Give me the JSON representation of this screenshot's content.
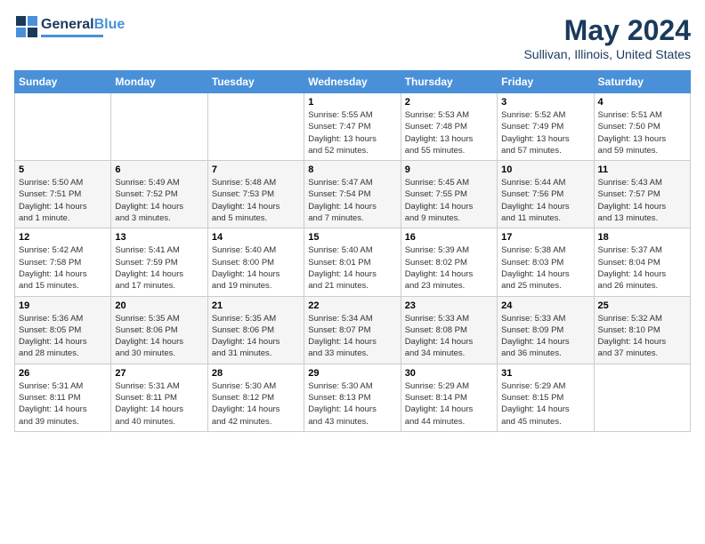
{
  "header": {
    "logo_general": "General",
    "logo_blue": "Blue",
    "month_year": "May 2024",
    "location": "Sullivan, Illinois, United States"
  },
  "weekdays": [
    "Sunday",
    "Monday",
    "Tuesday",
    "Wednesday",
    "Thursday",
    "Friday",
    "Saturday"
  ],
  "weeks": [
    [
      {
        "day": "",
        "info": ""
      },
      {
        "day": "",
        "info": ""
      },
      {
        "day": "",
        "info": ""
      },
      {
        "day": "1",
        "info": "Sunrise: 5:55 AM\nSunset: 7:47 PM\nDaylight: 13 hours\nand 52 minutes."
      },
      {
        "day": "2",
        "info": "Sunrise: 5:53 AM\nSunset: 7:48 PM\nDaylight: 13 hours\nand 55 minutes."
      },
      {
        "day": "3",
        "info": "Sunrise: 5:52 AM\nSunset: 7:49 PM\nDaylight: 13 hours\nand 57 minutes."
      },
      {
        "day": "4",
        "info": "Sunrise: 5:51 AM\nSunset: 7:50 PM\nDaylight: 13 hours\nand 59 minutes."
      }
    ],
    [
      {
        "day": "5",
        "info": "Sunrise: 5:50 AM\nSunset: 7:51 PM\nDaylight: 14 hours\nand 1 minute."
      },
      {
        "day": "6",
        "info": "Sunrise: 5:49 AM\nSunset: 7:52 PM\nDaylight: 14 hours\nand 3 minutes."
      },
      {
        "day": "7",
        "info": "Sunrise: 5:48 AM\nSunset: 7:53 PM\nDaylight: 14 hours\nand 5 minutes."
      },
      {
        "day": "8",
        "info": "Sunrise: 5:47 AM\nSunset: 7:54 PM\nDaylight: 14 hours\nand 7 minutes."
      },
      {
        "day": "9",
        "info": "Sunrise: 5:45 AM\nSunset: 7:55 PM\nDaylight: 14 hours\nand 9 minutes."
      },
      {
        "day": "10",
        "info": "Sunrise: 5:44 AM\nSunset: 7:56 PM\nDaylight: 14 hours\nand 11 minutes."
      },
      {
        "day": "11",
        "info": "Sunrise: 5:43 AM\nSunset: 7:57 PM\nDaylight: 14 hours\nand 13 minutes."
      }
    ],
    [
      {
        "day": "12",
        "info": "Sunrise: 5:42 AM\nSunset: 7:58 PM\nDaylight: 14 hours\nand 15 minutes."
      },
      {
        "day": "13",
        "info": "Sunrise: 5:41 AM\nSunset: 7:59 PM\nDaylight: 14 hours\nand 17 minutes."
      },
      {
        "day": "14",
        "info": "Sunrise: 5:40 AM\nSunset: 8:00 PM\nDaylight: 14 hours\nand 19 minutes."
      },
      {
        "day": "15",
        "info": "Sunrise: 5:40 AM\nSunset: 8:01 PM\nDaylight: 14 hours\nand 21 minutes."
      },
      {
        "day": "16",
        "info": "Sunrise: 5:39 AM\nSunset: 8:02 PM\nDaylight: 14 hours\nand 23 minutes."
      },
      {
        "day": "17",
        "info": "Sunrise: 5:38 AM\nSunset: 8:03 PM\nDaylight: 14 hours\nand 25 minutes."
      },
      {
        "day": "18",
        "info": "Sunrise: 5:37 AM\nSunset: 8:04 PM\nDaylight: 14 hours\nand 26 minutes."
      }
    ],
    [
      {
        "day": "19",
        "info": "Sunrise: 5:36 AM\nSunset: 8:05 PM\nDaylight: 14 hours\nand 28 minutes."
      },
      {
        "day": "20",
        "info": "Sunrise: 5:35 AM\nSunset: 8:06 PM\nDaylight: 14 hours\nand 30 minutes."
      },
      {
        "day": "21",
        "info": "Sunrise: 5:35 AM\nSunset: 8:06 PM\nDaylight: 14 hours\nand 31 minutes."
      },
      {
        "day": "22",
        "info": "Sunrise: 5:34 AM\nSunset: 8:07 PM\nDaylight: 14 hours\nand 33 minutes."
      },
      {
        "day": "23",
        "info": "Sunrise: 5:33 AM\nSunset: 8:08 PM\nDaylight: 14 hours\nand 34 minutes."
      },
      {
        "day": "24",
        "info": "Sunrise: 5:33 AM\nSunset: 8:09 PM\nDaylight: 14 hours\nand 36 minutes."
      },
      {
        "day": "25",
        "info": "Sunrise: 5:32 AM\nSunset: 8:10 PM\nDaylight: 14 hours\nand 37 minutes."
      }
    ],
    [
      {
        "day": "26",
        "info": "Sunrise: 5:31 AM\nSunset: 8:11 PM\nDaylight: 14 hours\nand 39 minutes."
      },
      {
        "day": "27",
        "info": "Sunrise: 5:31 AM\nSunset: 8:11 PM\nDaylight: 14 hours\nand 40 minutes."
      },
      {
        "day": "28",
        "info": "Sunrise: 5:30 AM\nSunset: 8:12 PM\nDaylight: 14 hours\nand 42 minutes."
      },
      {
        "day": "29",
        "info": "Sunrise: 5:30 AM\nSunset: 8:13 PM\nDaylight: 14 hours\nand 43 minutes."
      },
      {
        "day": "30",
        "info": "Sunrise: 5:29 AM\nSunset: 8:14 PM\nDaylight: 14 hours\nand 44 minutes."
      },
      {
        "day": "31",
        "info": "Sunrise: 5:29 AM\nSunset: 8:15 PM\nDaylight: 14 hours\nand 45 minutes."
      },
      {
        "day": "",
        "info": ""
      }
    ]
  ]
}
